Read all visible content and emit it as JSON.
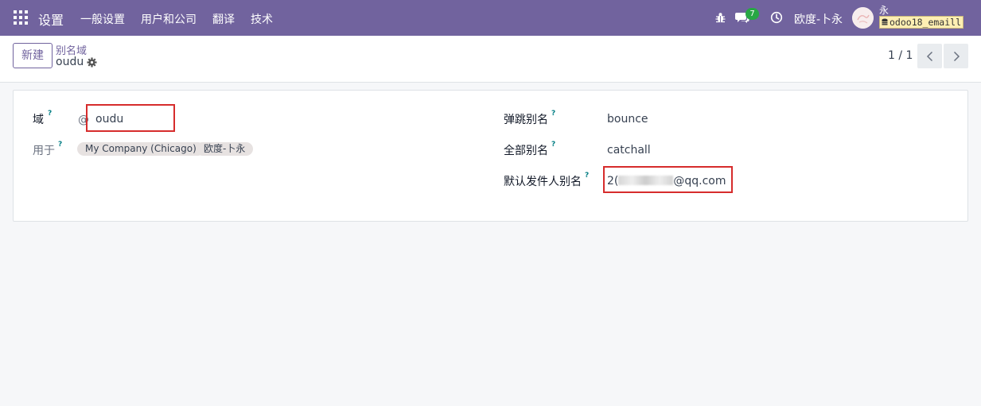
{
  "navbar": {
    "app_title": "设置",
    "menu": [
      "一般设置",
      "用户和公司",
      "翻译",
      "技术"
    ],
    "messages_count": "7",
    "company": "欧度-卜永",
    "user_name": "永",
    "database": "odoo18_emaill",
    "brand_color": "#71639e"
  },
  "control_panel": {
    "new_label": "新建",
    "breadcrumb_parent": "别名域",
    "breadcrumb_current": "oudu",
    "pager": "1 / 1"
  },
  "form": {
    "domain_label": "域",
    "help_mark": "?",
    "at_sign": "@",
    "domain_value": "oudu",
    "used_for_label": "用于",
    "used_for_tags": [
      "My Company (Chicago)",
      "欧度-卜永"
    ],
    "bounce_label": "弹跳别名",
    "bounce_value": "bounce",
    "catchall_label": "全部别名",
    "catchall_value": "catchall",
    "default_from_label": "默认发件人别名",
    "default_from_prefix": "2(",
    "default_from_suffix": "@qq.com",
    "highlight_color": "#d62c2c"
  }
}
